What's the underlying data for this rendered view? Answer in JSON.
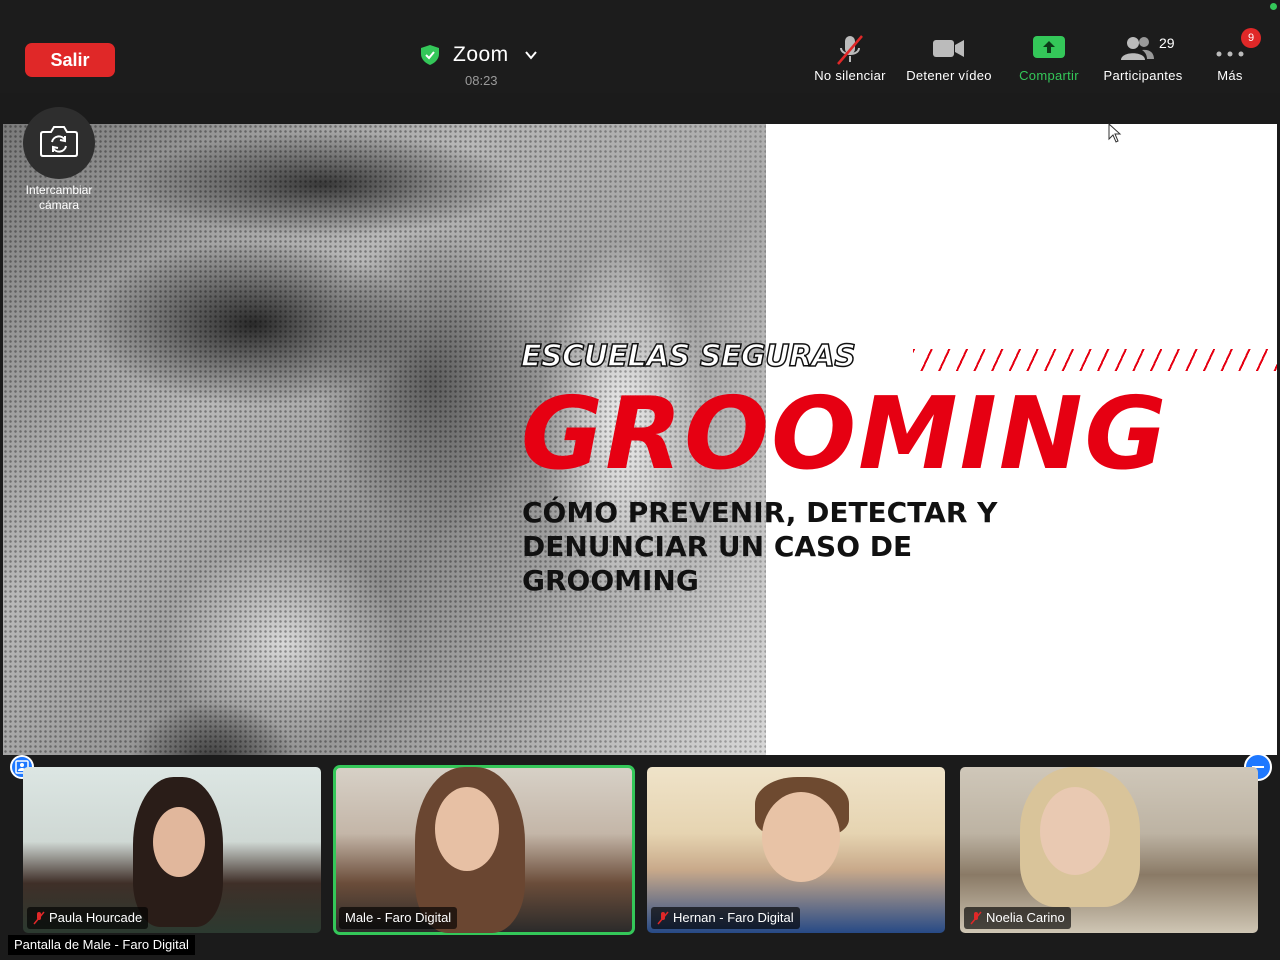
{
  "toolbar": {
    "leave_label": "Salir",
    "title": "Zoom",
    "timer": "08:23",
    "mute_label": "No silenciar",
    "video_label": "Detener vídeo",
    "share_label": "Compartir",
    "participants_label": "Participantes",
    "participants_count": "29",
    "more_label": "Más",
    "more_badge": "9"
  },
  "camera": {
    "swap_label": "Intercambiar cámara"
  },
  "slide": {
    "kicker": "ESCUELAS SEGURAS",
    "headline": "GROOMING",
    "subline": "CÓMO PREVENIR, DETECTAR Y DENUNCIAR UN CASO DE GROOMING"
  },
  "participants": [
    {
      "name": "Paula Hourcade",
      "muted": true
    },
    {
      "name": "Male - Faro Digital",
      "muted": false
    },
    {
      "name": "Hernan - Faro Digital",
      "muted": true
    },
    {
      "name": "Noelia Carino",
      "muted": true
    }
  ],
  "share_source": "Pantalla de Male - Faro Digital",
  "colors": {
    "leave": "#e02828",
    "share": "#34c759",
    "accent_red": "#e60012",
    "active_speaker": "#34c759",
    "pin": "#1e78ff"
  }
}
